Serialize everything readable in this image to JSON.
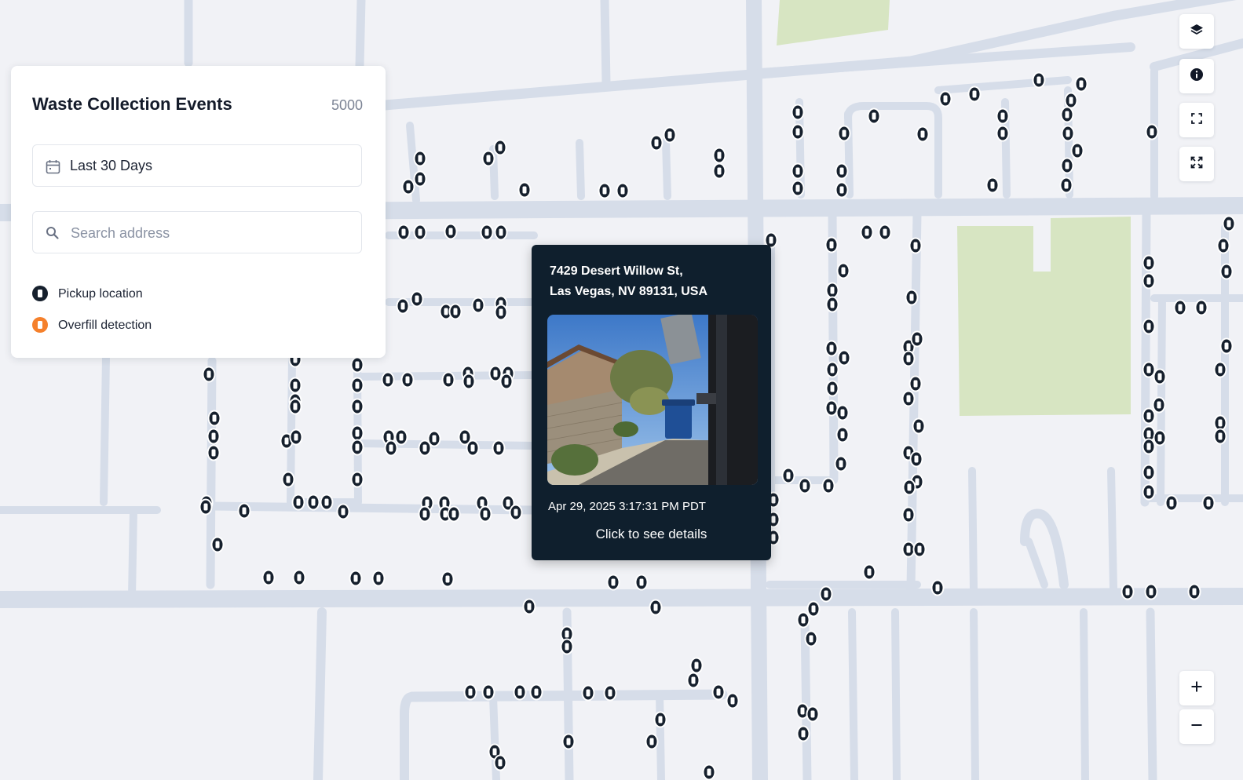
{
  "panel": {
    "title": "Waste Collection Events",
    "count": "5000",
    "date_filter": "Last 30 Days",
    "search_placeholder": "Search address",
    "legend": [
      {
        "label": "Pickup location",
        "color": "#16202d"
      },
      {
        "label": "Overfill detection",
        "color": "#f5802b"
      }
    ]
  },
  "popup": {
    "address_line1": "7429 Desert Willow St,",
    "address_line2": "Las Vegas, NV 89131, USA",
    "timestamp": "Apr 29, 2025 3:17:31 PM PDT",
    "link": "Click to see details"
  },
  "map_controls": [
    {
      "name": "layers-button",
      "icon": "layers-icon"
    },
    {
      "name": "info-button",
      "icon": "info-icon"
    },
    {
      "name": "fit-bounds-button",
      "icon": "fit-bounds-icon"
    },
    {
      "name": "fullscreen-button",
      "icon": "fullscreen-icon"
    }
  ],
  "zoom_controls": [
    {
      "name": "zoom-in-button",
      "icon": "plus-icon"
    },
    {
      "name": "zoom-out-button",
      "icon": "minus-icon"
    }
  ],
  "colors": {
    "map_background": "#f1f2f6",
    "road": "#d6dde9",
    "park": "#d7e5c2",
    "pin": "#16202d",
    "overfill": "#f5802b",
    "popup_background": "#0f1f2d"
  }
}
